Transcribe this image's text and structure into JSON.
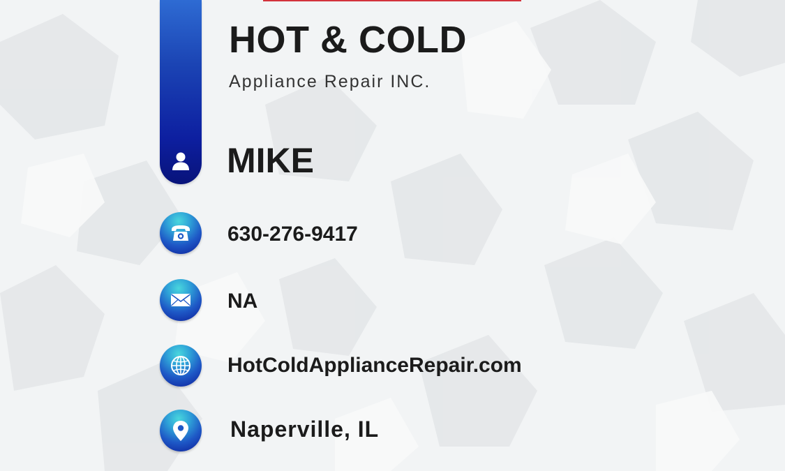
{
  "company": {
    "name": "HOT & COLD",
    "subtitle": "Appliance Repair INC."
  },
  "contact": {
    "person": "MIKE",
    "phone": "630-276-9417",
    "email": "NA",
    "website": "HotColdApplianceRepair.com",
    "location": "Naperville, IL"
  },
  "icons": {
    "person": "person-icon",
    "phone": "phone-icon",
    "email": "envelope-icon",
    "website": "globe-icon",
    "location": "map-pin-icon"
  },
  "colors": {
    "accent_blue": "#0d1fa0",
    "accent_cyan": "#49d6dd",
    "accent_red": "#d3323c",
    "text": "#1b1b1b"
  }
}
